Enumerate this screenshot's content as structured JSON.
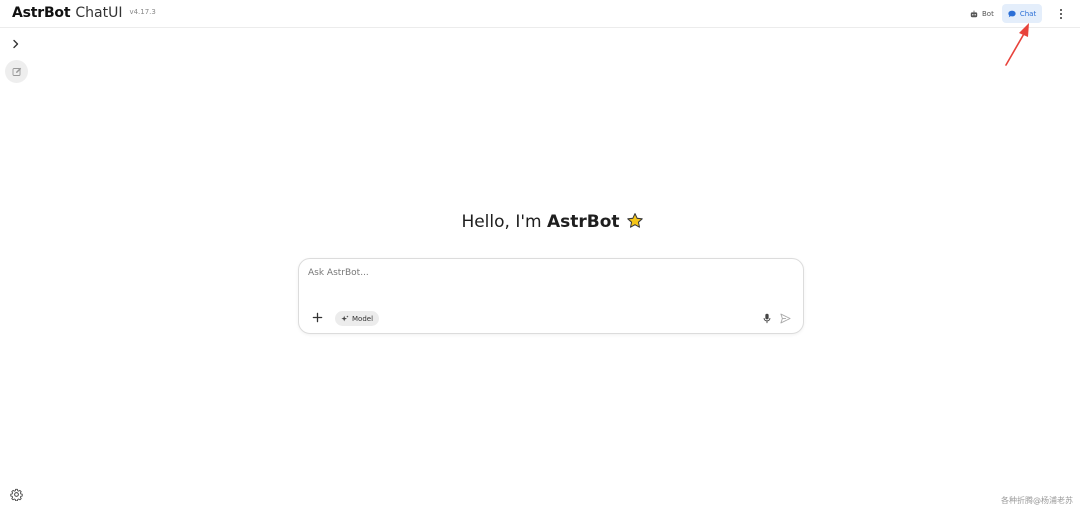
{
  "header": {
    "brand_name": "AstrBot",
    "brand_sub": "ChatUI",
    "version": "v4.17.3",
    "modes": [
      {
        "label": "Bot",
        "icon": "robot-icon",
        "active": false
      },
      {
        "label": "Chat",
        "icon": "chat-bubble-icon",
        "active": true
      }
    ],
    "more_icon": "more-vertical-icon"
  },
  "sidebar": {
    "toggle_icon": "chevron-right-icon",
    "new_chat_icon": "edit-icon",
    "settings_icon": "gear-icon"
  },
  "main": {
    "greeting_prefix": "Hello, I'm ",
    "greeting_name": "AstrBot",
    "greeting_icon": "star-icon"
  },
  "composer": {
    "placeholder": "Ask AstrBot...",
    "value": "",
    "model_label": "Model",
    "add_icon": "plus-icon",
    "model_icon": "sparkle-icon",
    "mic_icon": "microphone-icon",
    "send_icon": "send-icon"
  },
  "annotation": {
    "color": "#e8433b"
  },
  "watermark": "各种折腾@杨浦老苏",
  "colors": {
    "accent": "#2b6fd6",
    "accent_bg": "#e4eefb",
    "star": "#f5c518"
  }
}
